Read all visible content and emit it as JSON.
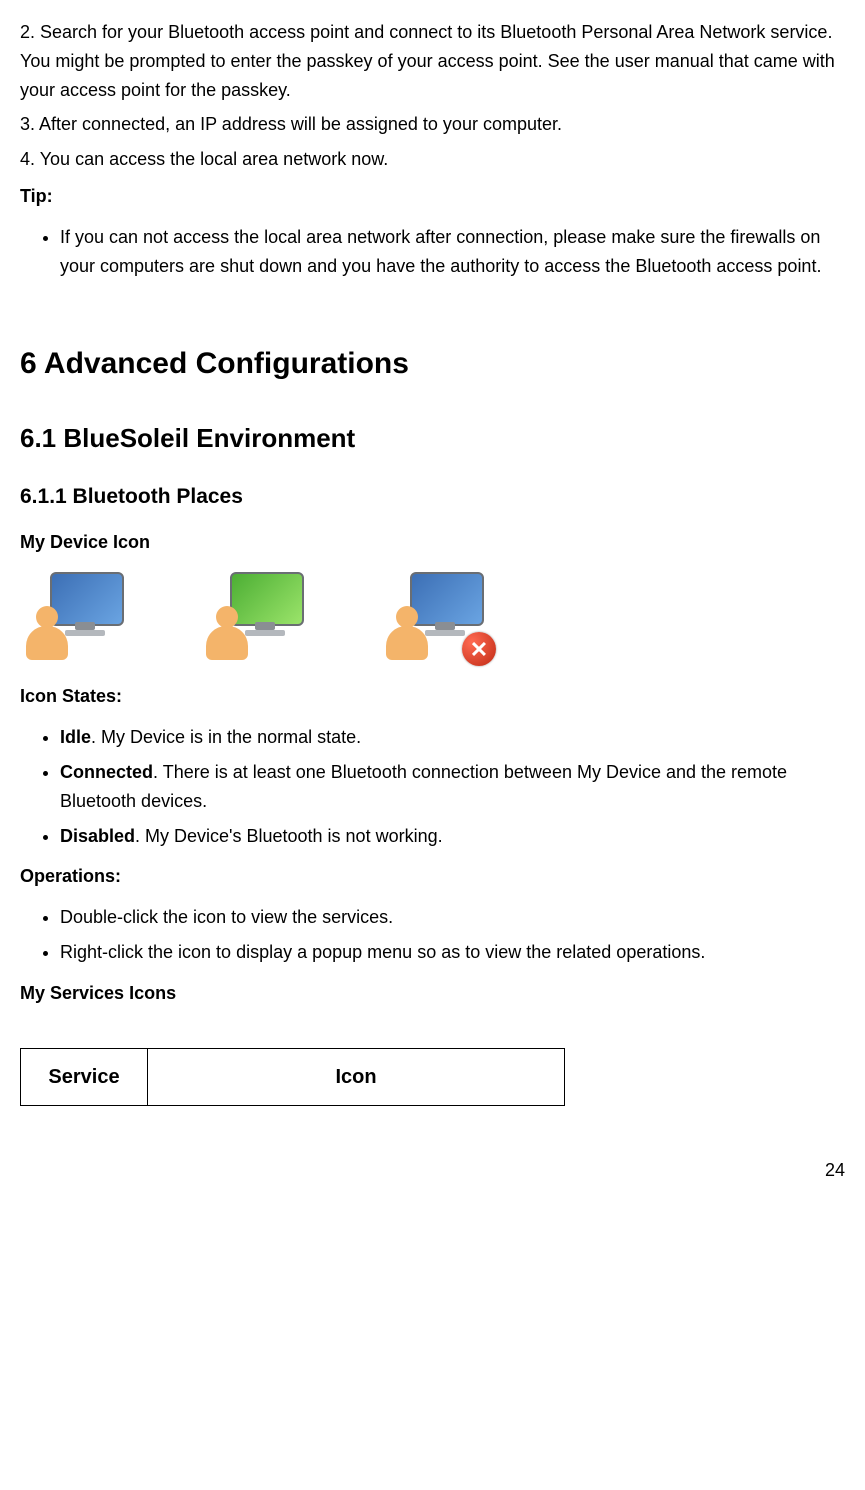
{
  "steps": {
    "s2": "2. Search for your Bluetooth access point and connect to its Bluetooth Personal Area Network service. You might be prompted to enter the passkey of your access point. See the user manual that came with your access point for the passkey.",
    "s3": "3. After connected, an IP address will be assigned to your computer.",
    "s4": "4. You can access the local area network now."
  },
  "tip": {
    "label": "Tip:",
    "items": [
      "If you can not access the local area network after connection, please make sure the firewalls on your computers are shut down and you have the authority to access the Bluetooth access point."
    ]
  },
  "h1": "6    Advanced Configurations",
  "h2": "6.1   BlueSoleil Environment",
  "h3": "6.1.1    Bluetooth Places",
  "myDeviceIcon": "My Device Icon",
  "iconStatesLabel": "Icon States:",
  "iconStates": [
    {
      "term": "Idle",
      "rest": ". My Device is in the normal state."
    },
    {
      "term": "Connected",
      "rest": ". There is at least one Bluetooth connection between My Device and the remote Bluetooth devices."
    },
    {
      "term": "Disabled",
      "rest": ". My Device's Bluetooth is not working."
    }
  ],
  "operationsLabel": "Operations:",
  "operations": [
    "Double-click the icon to view the services.",
    "Right-click the icon to display a popup menu so as to view the related operations."
  ],
  "myServicesIcons": "My Services Icons",
  "table": {
    "service": "Service",
    "icon": "Icon"
  },
  "pageNumber": "24"
}
